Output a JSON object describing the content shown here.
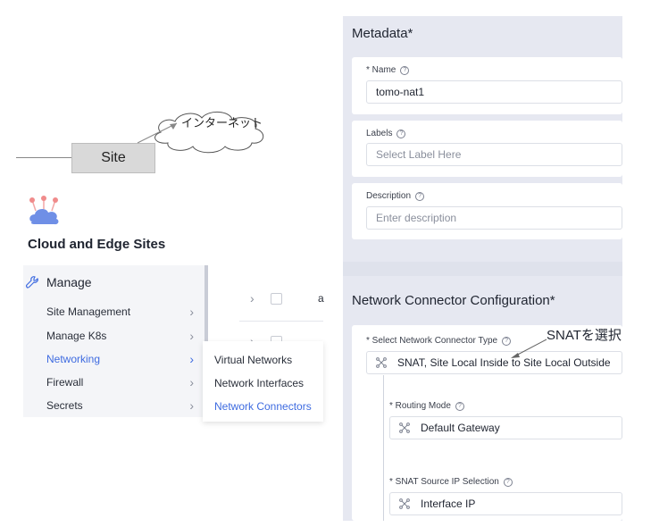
{
  "diagram": {
    "site_label": "Site",
    "internet_label": "インターネット"
  },
  "app": {
    "icon": "cloud-edge-icon",
    "title": "Cloud and Edge Sites"
  },
  "menu": {
    "header": {
      "icon": "wrench-icon",
      "label": "Manage"
    },
    "items": [
      {
        "label": "Site Management",
        "active": false
      },
      {
        "label": "Manage K8s",
        "active": false
      },
      {
        "label": "Networking",
        "active": true
      },
      {
        "label": "Firewall",
        "active": false
      },
      {
        "label": "Secrets",
        "active": false
      }
    ],
    "chevron": "›"
  },
  "table": {
    "row1_text": "a"
  },
  "submenu": {
    "items": [
      {
        "label": "Virtual Networks",
        "active": false
      },
      {
        "label": "Network Interfaces",
        "active": false
      },
      {
        "label": "Network Connectors",
        "active": true
      }
    ]
  },
  "form": {
    "metadata": {
      "title": "Metadata",
      "required_mark": "*",
      "name_label": "* Name",
      "name_value": "tomo-nat1",
      "labels_label": "Labels",
      "labels_placeholder": "Select Label Here",
      "description_label": "Description",
      "description_placeholder": "Enter description"
    },
    "config": {
      "title": "Network Connector Configuration",
      "required_mark": "*",
      "type_label": "* Select Network Connector Type",
      "type_value": "SNAT, Site Local Inside to Site Local Outside",
      "routing_label": "* Routing Mode",
      "routing_value": "Default Gateway",
      "snat_label": "* SNAT Source IP Selection",
      "snat_value": "Interface IP"
    },
    "help_glyph": "?"
  },
  "annotation": {
    "text": "SNATを選択"
  },
  "colors": {
    "accent": "#3e6be0",
    "panel_bg": "#e6e8f1",
    "menu_bg": "#f4f5f8"
  }
}
